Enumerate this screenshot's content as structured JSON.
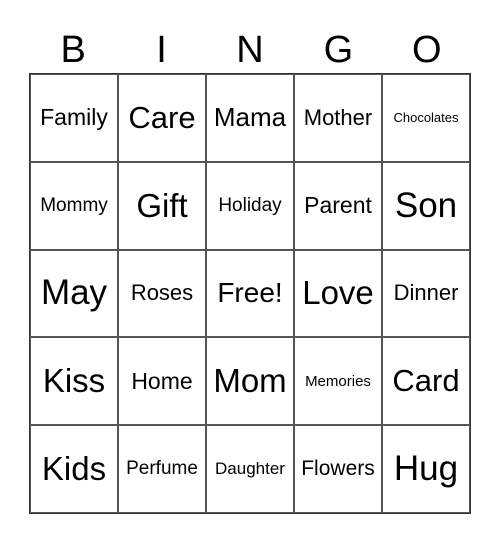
{
  "header": [
    "B",
    "I",
    "N",
    "G",
    "O"
  ],
  "cells": [
    {
      "text": "Family",
      "size": "s23"
    },
    {
      "text": "Care",
      "size": "s31"
    },
    {
      "text": "Mama",
      "size": "s26"
    },
    {
      "text": "Mother",
      "size": "s22"
    },
    {
      "text": "Chocolates",
      "size": "s13"
    },
    {
      "text": "Mommy",
      "size": "s19"
    },
    {
      "text": "Gift",
      "size": "s33"
    },
    {
      "text": "Holiday",
      "size": "s19"
    },
    {
      "text": "Parent",
      "size": "s23"
    },
    {
      "text": "Son",
      "size": "s35"
    },
    {
      "text": "May",
      "size": "s35"
    },
    {
      "text": "Roses",
      "size": "s22"
    },
    {
      "text": "Free!",
      "size": "s28"
    },
    {
      "text": "Love",
      "size": "s33"
    },
    {
      "text": "Dinner",
      "size": "s22"
    },
    {
      "text": "Kiss",
      "size": "s33"
    },
    {
      "text": "Home",
      "size": "s23"
    },
    {
      "text": "Mom",
      "size": "s33"
    },
    {
      "text": "Memories",
      "size": "s15"
    },
    {
      "text": "Card",
      "size": "s31"
    },
    {
      "text": "Kids",
      "size": "s33"
    },
    {
      "text": "Perfume",
      "size": "s19"
    },
    {
      "text": "Daughter",
      "size": "s17"
    },
    {
      "text": "Flowers",
      "size": "s21"
    },
    {
      "text": "Hug",
      "size": "s35"
    }
  ]
}
